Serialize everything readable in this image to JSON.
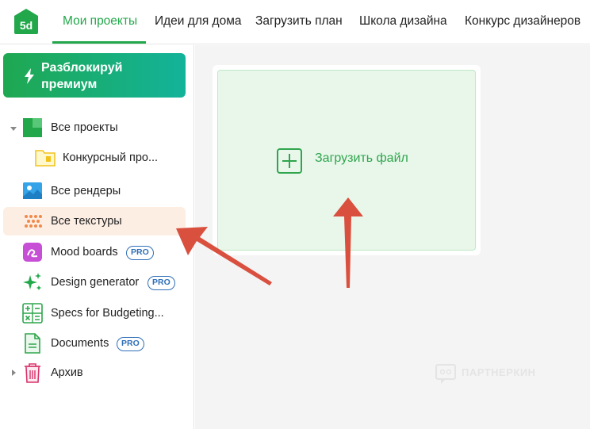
{
  "brand": {
    "logo_text": "5d",
    "accent": "#22a84a"
  },
  "nav": {
    "items": [
      {
        "label": "Мои проекты",
        "active": true
      },
      {
        "label": "Идеи для дома",
        "active": false
      },
      {
        "label": "Загрузить план",
        "active": false
      },
      {
        "label": "Школа дизайна",
        "active": false
      },
      {
        "label": "Конкурс дизайнеров",
        "active": false
      }
    ]
  },
  "sidebar": {
    "premium_label": "Разблокируй премиум",
    "items": [
      {
        "label": "Все проекты",
        "icon": "projects-icon",
        "expandable": true
      },
      {
        "label": "Конкурсный про...",
        "icon": "folder-icon",
        "child": true
      },
      {
        "label": "Все рендеры",
        "icon": "image-icon"
      },
      {
        "label": "Все текстуры",
        "icon": "texture-icon",
        "active": true
      },
      {
        "label": "Mood boards",
        "icon": "moodboard-icon",
        "badge": "PRO"
      },
      {
        "label": "Design generator",
        "icon": "sparkle-icon",
        "badge": "PRO"
      },
      {
        "label": "Specs for Budgeting...",
        "icon": "calculator-icon"
      },
      {
        "label": "Documents",
        "icon": "document-icon",
        "badge": "PRO"
      },
      {
        "label": "Архив",
        "icon": "trash-icon",
        "expandable": true
      }
    ]
  },
  "main": {
    "upload_label": "Загрузить файл"
  },
  "watermark": {
    "text": "ПАРТНЕРКИН"
  },
  "colors": {
    "active_row": "#fdeee4",
    "pro_badge": "#2f6fb8",
    "arrow": "#d9503f"
  }
}
